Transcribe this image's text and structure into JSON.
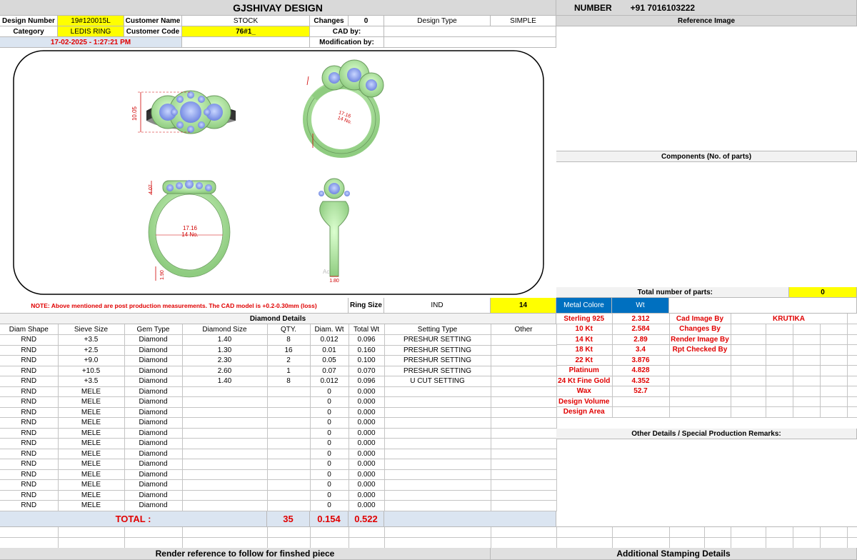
{
  "header": {
    "title": "GJSHIVAY DESIGN",
    "number_label": "NUMBER",
    "number_value": "+91 7016103222"
  },
  "info": {
    "design_number_label": "Design Number",
    "design_number": "19#120015L",
    "customer_name_label": "Customer Name",
    "customer_name": "STOCK",
    "changes_label": "Changes",
    "changes": "0",
    "design_type_label": "Design Type",
    "design_type": "SIMPLE",
    "category_label": "Category",
    "category": "LEDIS RING",
    "customer_code_label": "Customer Code",
    "customer_code": "76#1_",
    "cad_by_label": "CAD by:",
    "datetime": "17-02-2025 - 1:27:21 PM",
    "modification_label": "Modification by:"
  },
  "right_panel": {
    "reference_image": "Reference Image",
    "components": "Components (No. of parts)",
    "total_parts_label": "Total number of parts:",
    "total_parts": "0"
  },
  "drawing": {
    "top_height": "10.05",
    "top_size": "17.16",
    "top_size_no": "14 No.",
    "front_size": "17.16",
    "front_size_no": "14 No.",
    "front_height": "4.07",
    "front_shank": "1.90",
    "side_shank": "1.80",
    "watermark": "Ac"
  },
  "note": {
    "text": "NOTE: Above mentioned are post production measurements. The CAD model is +0.2-0.30mm (loss)",
    "ring_size_label": "Ring Size",
    "ring_std": "IND",
    "ring_size": "14"
  },
  "diamond": {
    "title": "Diamond Details",
    "headers": [
      "Diam Shape",
      "Sieve Size",
      "Gem Type",
      "Diamond Size",
      "QTY.",
      "Diam. Wt",
      "Total Wt",
      "Setting Type",
      "Other"
    ],
    "rows": [
      [
        "RND",
        "+3.5",
        "Diamond",
        "1.40",
        "8",
        "0.012",
        "0.096",
        "PRESHUR SETTING",
        ""
      ],
      [
        "RND",
        "+2.5",
        "Diamond",
        "1.30",
        "16",
        "0.01",
        "0.160",
        "PRESHUR SETTING",
        ""
      ],
      [
        "RND",
        "+9.0",
        "Diamond",
        "2.30",
        "2",
        "0.05",
        "0.100",
        "PRESHUR SETTING",
        ""
      ],
      [
        "RND",
        "+10.5",
        "Diamond",
        "2.60",
        "1",
        "0.07",
        "0.070",
        "PRESHUR SETTING",
        ""
      ],
      [
        "RND",
        "+3.5",
        "Diamond",
        "1.40",
        "8",
        "0.012",
        "0.096",
        "U CUT SETTING",
        ""
      ],
      [
        "RND",
        "MELE",
        "Diamond",
        "",
        "",
        "0",
        "0.000",
        "",
        ""
      ],
      [
        "RND",
        "MELE",
        "Diamond",
        "",
        "",
        "0",
        "0.000",
        "",
        ""
      ],
      [
        "RND",
        "MELE",
        "Diamond",
        "",
        "",
        "0",
        "0.000",
        "",
        ""
      ],
      [
        "RND",
        "MELE",
        "Diamond",
        "",
        "",
        "0",
        "0.000",
        "",
        ""
      ],
      [
        "RND",
        "MELE",
        "Diamond",
        "",
        "",
        "0",
        "0.000",
        "",
        ""
      ],
      [
        "RND",
        "MELE",
        "Diamond",
        "",
        "",
        "0",
        "0.000",
        "",
        ""
      ],
      [
        "RND",
        "MELE",
        "Diamond",
        "",
        "",
        "0",
        "0.000",
        "",
        ""
      ],
      [
        "RND",
        "MELE",
        "Diamond",
        "",
        "",
        "0",
        "0.000",
        "",
        ""
      ],
      [
        "RND",
        "MELE",
        "Diamond",
        "",
        "",
        "0",
        "0.000",
        "",
        ""
      ],
      [
        "RND",
        "MELE",
        "Diamond",
        "",
        "",
        "0",
        "0.000",
        "",
        ""
      ],
      [
        "RND",
        "MELE",
        "Diamond",
        "",
        "",
        "0",
        "0.000",
        "",
        ""
      ],
      [
        "RND",
        "MELE",
        "Diamond",
        "",
        "",
        "0",
        "0.000",
        "",
        ""
      ]
    ],
    "total_label": "TOTAL :",
    "total_qty": "35",
    "total_diam_wt": "0.154",
    "total_wt": "0.522"
  },
  "metal": {
    "header_label": "Metal Colore",
    "header_wt": "Wt",
    "rows": [
      {
        "name": "Sterling 925",
        "wt": "2.312",
        "k": "Cad Image By",
        "v": "KRUTIKA"
      },
      {
        "name": "10 Kt",
        "wt": "2.584",
        "k": "Changes By",
        "v": ""
      },
      {
        "name": "14 Kt",
        "wt": "2.89",
        "k": "Render Image By",
        "v": ""
      },
      {
        "name": "18 Kt",
        "wt": "3.4",
        "k": "Rpt Checked By",
        "v": ""
      },
      {
        "name": "22 Kt",
        "wt": "3.876",
        "k": "",
        "v": ""
      },
      {
        "name": "Platinum",
        "wt": "4.828",
        "k": "",
        "v": ""
      },
      {
        "name": "24 Kt Fine Gold",
        "wt": "4.352",
        "k": "",
        "v": ""
      },
      {
        "name": "Wax",
        "wt": "52.7",
        "k": "",
        "v": ""
      },
      {
        "name": "Design Volume",
        "wt": "",
        "k": "",
        "v": ""
      },
      {
        "name": "Design Area",
        "wt": "",
        "k": "",
        "v": ""
      }
    ],
    "other_details": "Other Details / Special Production Remarks:"
  },
  "footer": {
    "render_ref": "Render reference to follow for finshed piece",
    "stamping": "Additional Stamping Details"
  },
  "colors": {
    "yellow": "#ffff00",
    "blue": "#0070c0",
    "light_blue": "#dbe5f1",
    "red": "#e00000",
    "ring_green": "#b6f0a8",
    "gem_blue": "#8fa8f0"
  }
}
